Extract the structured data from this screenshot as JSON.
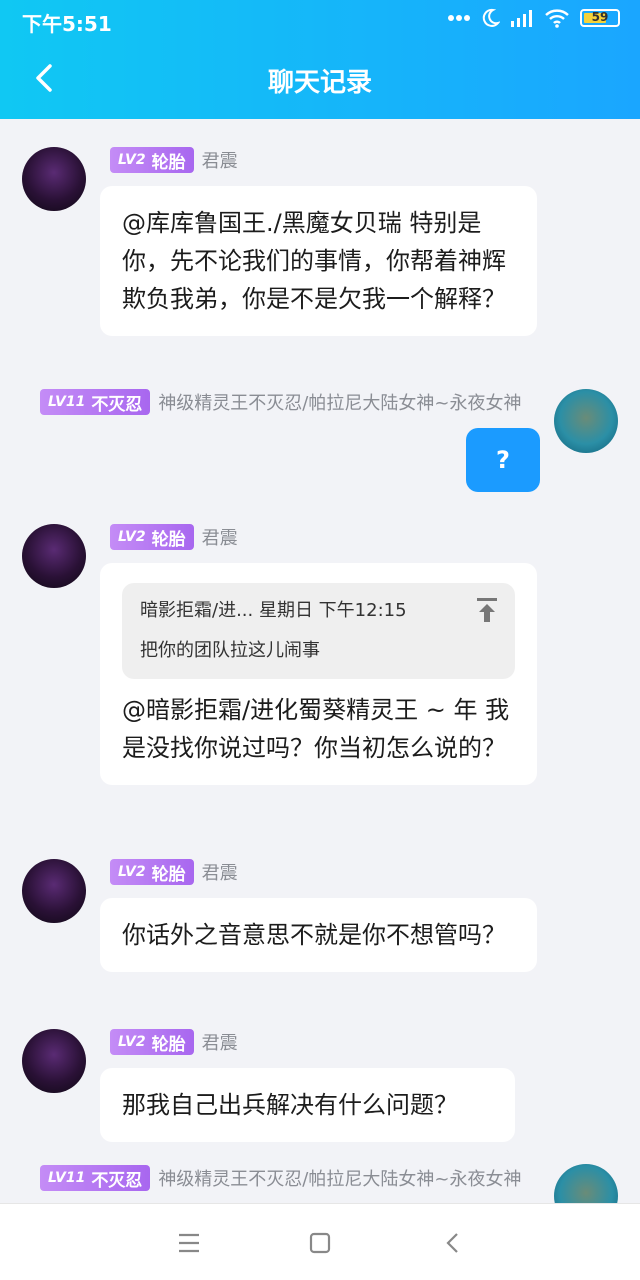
{
  "status": {
    "time": "下午5:51",
    "battery": "59"
  },
  "header": {
    "title": "聊天记录"
  },
  "messages": [
    {
      "badge_lv": "LV2",
      "badge_text": "轮胎",
      "name": "君震",
      "text": "@库库鲁国王./黑魔女贝瑞 特别是你，先不论我们的事情，你帮着神辉欺负我弟，你是不是欠我一个解释？"
    },
    {
      "badge_lv": "LV11",
      "badge_text": "不灭忍",
      "name": "神级精灵王不灭忍/帕拉尼大陆女神~永夜女神",
      "text": "?"
    },
    {
      "badge_lv": "LV2",
      "badge_text": "轮胎",
      "name": "君震",
      "quote_head": "暗影拒霜/进... 星期日 下午12:15",
      "quote_body": "把你的团队拉这儿闹事",
      "text": "@暗影拒霜/进化蜀葵精灵王 ~ 年 我是没找你说过吗？你当初怎么说的？"
    },
    {
      "badge_lv": "LV2",
      "badge_text": "轮胎",
      "name": "君震",
      "text": "你话外之音意思不就是你不想管吗？"
    },
    {
      "badge_lv": "LV2",
      "badge_text": "轮胎",
      "name": "君震",
      "text": "那我自己出兵解决有什么问题？"
    },
    {
      "badge_lv": "LV11",
      "badge_text": "不灭忍",
      "name": "神级精灵王不灭忍/帕拉尼大陆女神~永夜女神"
    }
  ],
  "colors": {
    "header_start": "#10c8f3",
    "header_end": "#1aa6ff",
    "badge": "#b57af2",
    "self_bubble": "#1b9bff"
  }
}
